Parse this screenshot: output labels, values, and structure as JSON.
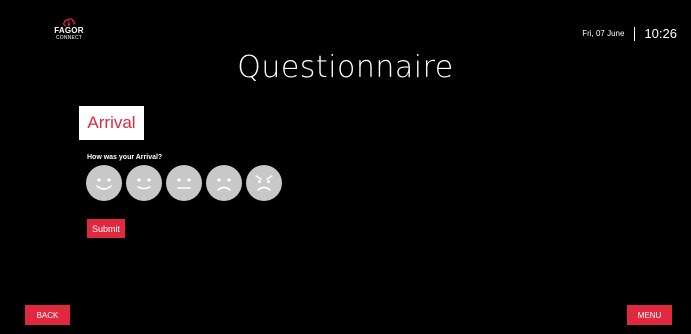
{
  "header": {
    "logo": {
      "icon": "fagor-cloud-icon",
      "brand": "FAGOR",
      "sub": "CONNECT"
    },
    "date": "Fri, 07 June",
    "time": "10:26"
  },
  "page": {
    "title": "Questionnaire",
    "section_label": "Arrival",
    "question": "How was your Arrival?"
  },
  "rating": {
    "options": [
      {
        "icon": "very-happy-face-icon"
      },
      {
        "icon": "happy-face-icon"
      },
      {
        "icon": "neutral-face-icon"
      },
      {
        "icon": "sad-face-icon"
      },
      {
        "icon": "angry-face-icon"
      }
    ]
  },
  "actions": {
    "submit_label": "Submit",
    "back_label": "BACK",
    "menu_label": "MENU"
  },
  "colors": {
    "background": "#000000",
    "accent": "#e0283f",
    "face_fill": "#c8c8c8",
    "face_stroke": "#ffffff"
  }
}
